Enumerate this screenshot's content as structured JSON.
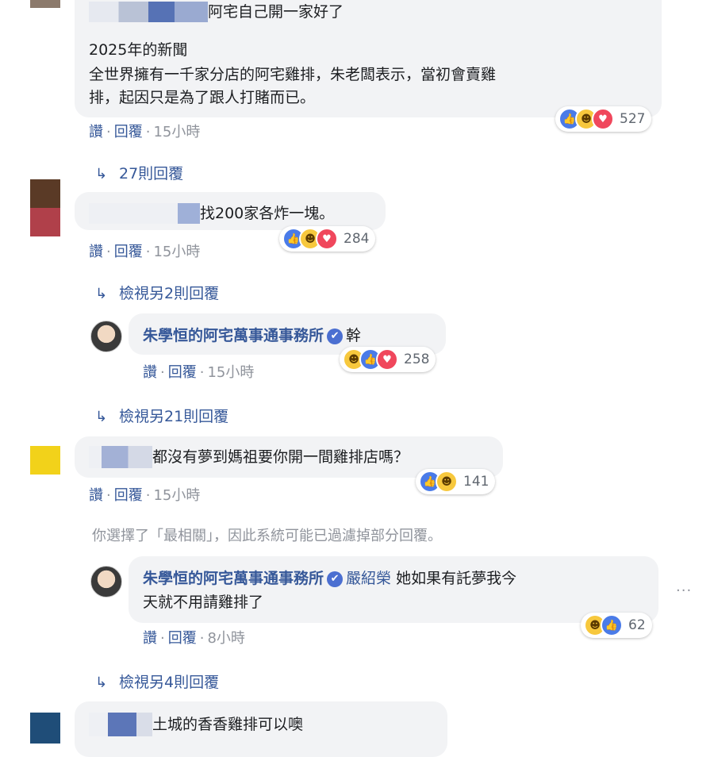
{
  "comments": [
    {
      "text_line1": "阿宅自己開一家好了",
      "text_line2": "2025年的新聞",
      "text_line3": "全世界擁有一千家分店的阿宅雞排，朱老闆表示，當初會賣雞",
      "text_line4": "排，起因只是為了跟人打賭而已。",
      "reaction_count": "527",
      "time": "15小時",
      "replies_link": "27則回覆"
    },
    {
      "text": "找200家各炸一塊。",
      "reaction_count": "284",
      "time": "15小時",
      "replies_link": "檢視另2則回覆"
    },
    {
      "text": "都沒有夢到媽祖要你開一間雞排店嗎？",
      "reaction_count": "141",
      "time": "15小時"
    },
    {
      "text": "土城的香香雞排可以噢"
    }
  ],
  "page_replies": [
    {
      "author": "朱學恒的阿宅萬事通事務所",
      "text": "幹",
      "reaction_count": "258",
      "time": "15小時",
      "replies_link": "檢視另21則回覆"
    },
    {
      "author": "朱學恒的阿宅萬事通事務所",
      "mention": "嚴紹榮",
      "text_line1": "她如果有託夢我今",
      "text_line2": "天就不用請雞排了",
      "reaction_count": "62",
      "time": "8小時",
      "replies_link": "檢視另4則回覆"
    }
  ],
  "actions": {
    "like": "讚",
    "reply": "回覆",
    "separator": "·"
  },
  "filter_notice": "你選擇了「最相關」，因此系統可能已過濾掉部分回覆。",
  "options_dots": "···",
  "reply_arrow": "↳",
  "verified_mark": "✔",
  "colors": {
    "link": "#365899",
    "bubble": "#f2f3f5",
    "like": "#4a7be8",
    "haha": "#f7c83d",
    "love": "#f0475c"
  }
}
